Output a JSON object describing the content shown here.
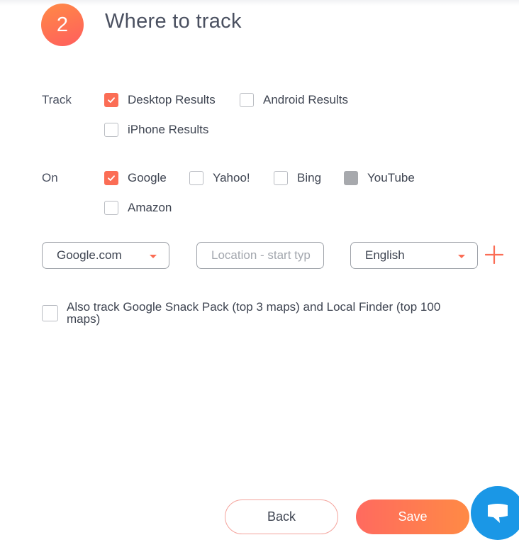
{
  "header": {
    "step_number": "2",
    "title": "Where to track"
  },
  "track": {
    "label": "Track",
    "options": [
      {
        "label": "Desktop Results",
        "checked": true
      },
      {
        "label": "Android Results",
        "checked": false
      },
      {
        "label": "iPhone Results",
        "checked": false
      }
    ]
  },
  "on": {
    "label": "On",
    "options": [
      {
        "label": "Google",
        "checked": true
      },
      {
        "label": "Yahoo!",
        "checked": false
      },
      {
        "label": "Bing",
        "checked": false
      },
      {
        "label": "YouTube",
        "checked": false,
        "disabled": true
      },
      {
        "label": "Amazon",
        "checked": false
      }
    ]
  },
  "search_config": {
    "engine_value": "Google.com",
    "location_placeholder": "Location - start typing",
    "language_value": "English"
  },
  "snack_pack": {
    "label": "Also track Google Snack Pack (top 3 maps) and Local Finder (top 100 maps)",
    "checked": false
  },
  "footer": {
    "back_label": "Back",
    "save_label": "Save"
  },
  "colors": {
    "accent": "#fb6d55",
    "chat": "#1a97e6"
  }
}
